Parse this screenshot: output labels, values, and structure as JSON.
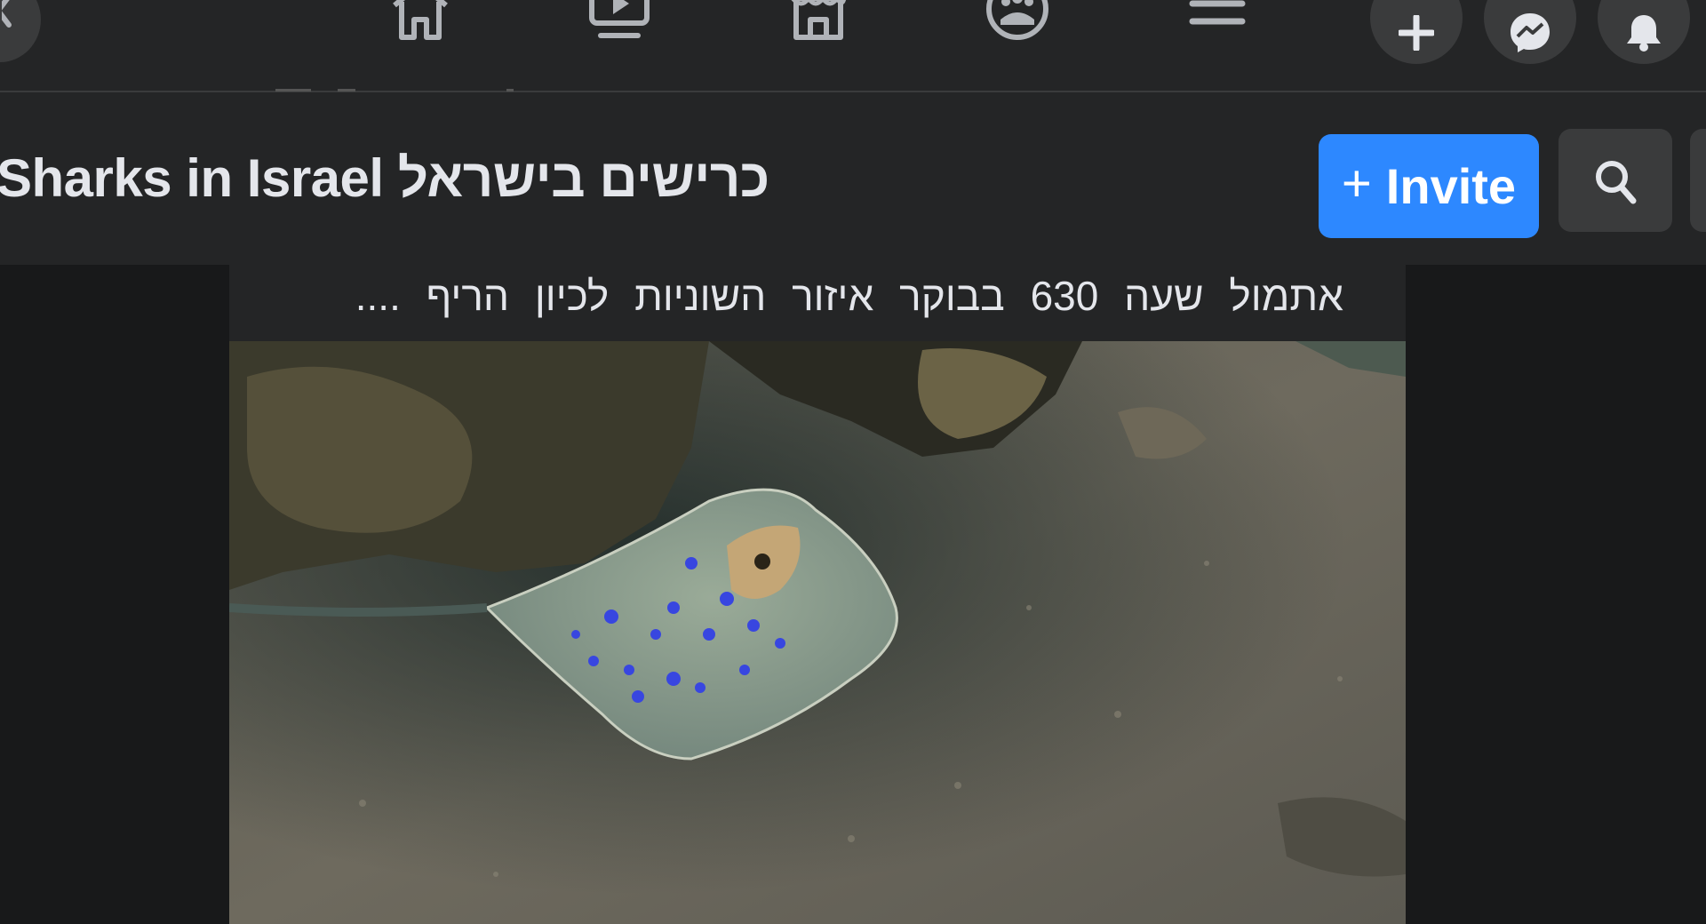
{
  "nav": {
    "icons": [
      "chevron-left-icon",
      "home-icon",
      "watch-icon",
      "marketplace-icon",
      "groups-icon",
      "menu-icon",
      "plus-icon",
      "messenger-icon",
      "bell-icon"
    ]
  },
  "group": {
    "title": "Sharks in Israel כרישים בישראל",
    "invite_label": "Invite",
    "invite_plus": "+"
  },
  "post": {
    "text": "אתמול שעה 630 בבוקר איזור השוניות לכיון הריף ....",
    "media_description_icon": "video-thumbnail-stingray"
  },
  "colors": {
    "topbar_bg": "#242526",
    "page_bg": "#18191a",
    "button_bg": "#3a3b3c",
    "accent_blue": "#2d88ff",
    "text_primary": "#e4e6eb"
  }
}
